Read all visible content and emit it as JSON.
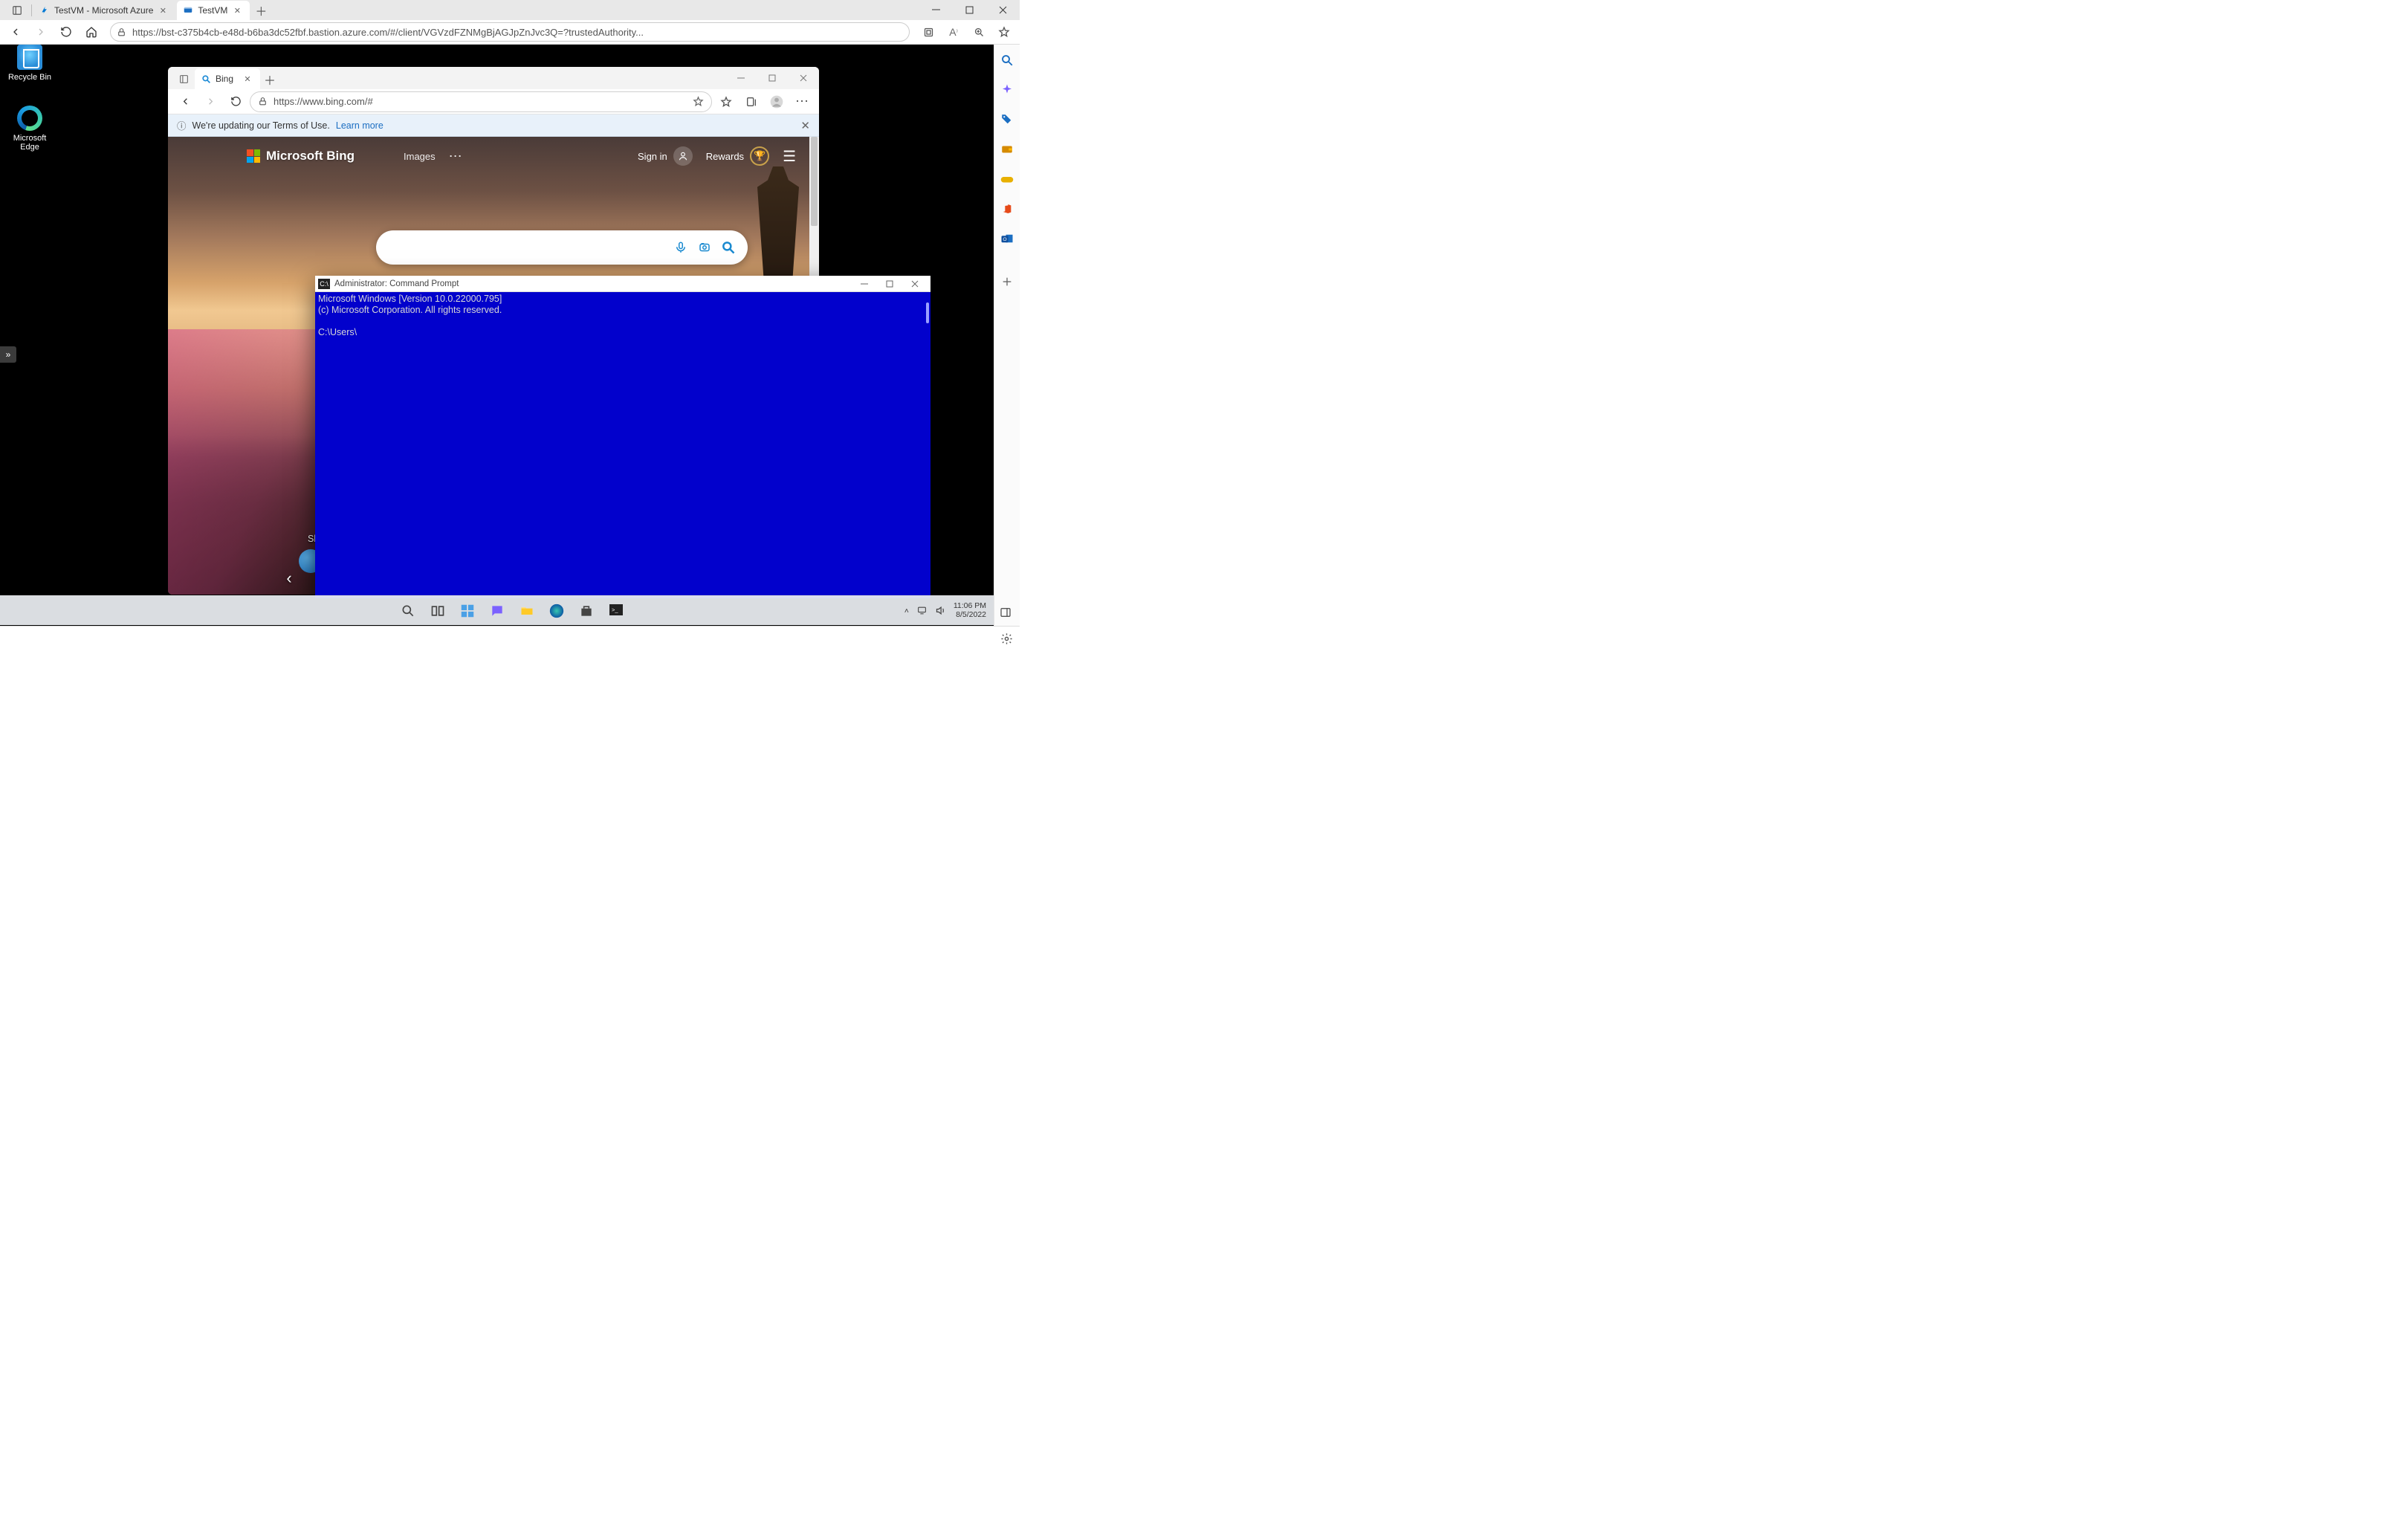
{
  "outer": {
    "tabs": [
      {
        "title": "TestVM  - Microsoft Azure",
        "favicon": "azure"
      },
      {
        "title": "TestVM",
        "favicon": "bastion"
      }
    ],
    "active_tab_index": 1,
    "url": "https://bst-c375b4cb-e48d-b6ba3dc52fbf.bastion.azure.com/#/client/VGVzdFZNMgBjAGJpZnJvc3Q=?trustedAuthority...",
    "sidebar_icons": [
      "search",
      "copilot",
      "shopping-tag",
      "wallet",
      "games",
      "office",
      "outlook",
      "add"
    ]
  },
  "remote": {
    "desktop_icons": {
      "recycle": "Recycle Bin",
      "edge": "Microsoft Edge"
    },
    "taskbar": {
      "time": "11:06 PM",
      "date": "8/5/2022"
    }
  },
  "inner": {
    "tab_title": "Bing",
    "url": "https://www.bing.com/#",
    "banner_text": "We're updating our Terms of Use.",
    "banner_link": "Learn more",
    "brand": "Microsoft Bing",
    "nav_images": "Images",
    "signin": "Sign in",
    "rewards": "Rewards",
    "sheet_label": "Sh"
  },
  "cmd": {
    "title": "Administrator: Command Prompt",
    "line1": "Microsoft Windows [Version 10.0.22000.795]",
    "line2": "(c) Microsoft Corporation. All rights reserved.",
    "prompt": "C:\\Users\\"
  }
}
